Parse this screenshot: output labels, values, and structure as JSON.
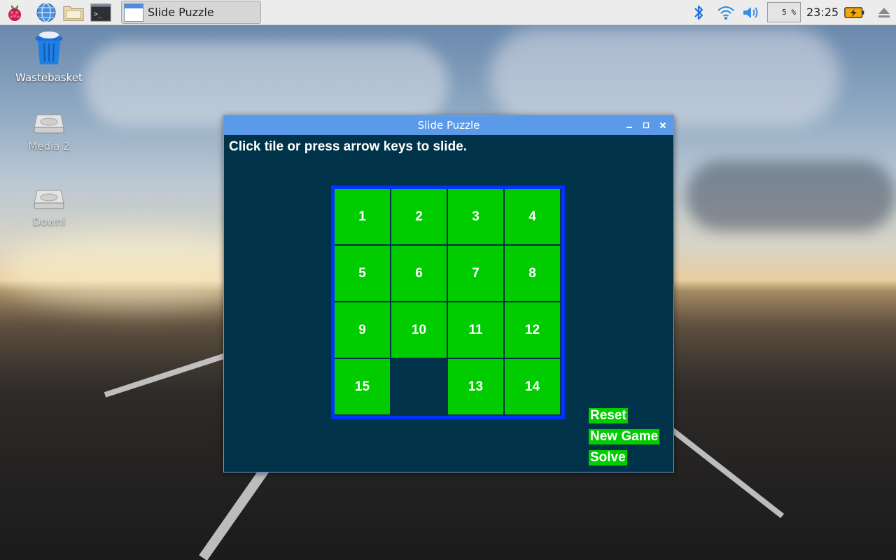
{
  "taskbar": {
    "task_label": "Slide Puzzle",
    "cpu": "5 %",
    "clock": "23:25",
    "icons": [
      "raspberry-menu-icon",
      "web-browser-icon",
      "file-manager-icon",
      "terminal-icon",
      "bluetooth-icon",
      "wifi-icon",
      "volume-icon",
      "battery-icon",
      "eject-icon"
    ]
  },
  "desktop": {
    "icons": [
      {
        "label": "Wastebasket",
        "icon": "wastebasket-icon"
      },
      {
        "label": "Media 2",
        "icon": "drive-icon"
      },
      {
        "label": "Downl",
        "icon": "drive-icon"
      }
    ]
  },
  "window": {
    "title": "Slide Puzzle",
    "instructions": "Click tile or press arrow keys to slide.",
    "board": {
      "rows": [
        [
          "1",
          "2",
          "3",
          "4"
        ],
        [
          "5",
          "6",
          "7",
          "8"
        ],
        [
          "9",
          "10",
          "11",
          "12"
        ],
        [
          "15",
          "",
          "13",
          "14"
        ]
      ]
    },
    "buttons": {
      "reset": "Reset",
      "new_game": "New Game",
      "solve": "Solve"
    },
    "colors": {
      "background": "#003349",
      "tile": "#00cc00",
      "border": "#0033ff",
      "text": "#ffffff"
    }
  }
}
